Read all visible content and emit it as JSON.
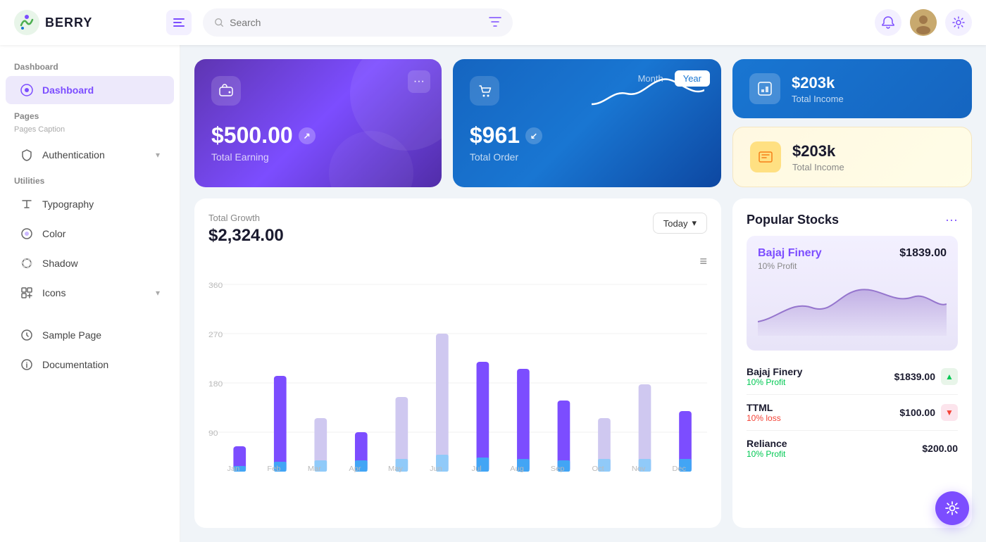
{
  "header": {
    "logo_text": "BERRY",
    "search_placeholder": "Search",
    "hamburger_label": "menu"
  },
  "sidebar": {
    "dashboard_section": "Dashboard",
    "dashboard_item": "Dashboard",
    "pages_section": "Pages",
    "pages_caption": "Pages Caption",
    "auth_item": "Authentication",
    "utilities_section": "Utilities",
    "typography_item": "Typography",
    "color_item": "Color",
    "shadow_item": "Shadow",
    "icons_item": "Icons",
    "sample_page_item": "Sample Page",
    "documentation_item": "Documentation"
  },
  "cards": {
    "earning_amount": "$500.00",
    "earning_label": "Total Earning",
    "order_amount": "$961",
    "order_label": "Total Order",
    "toggle_month": "Month",
    "toggle_year": "Year",
    "income_blue_amount": "$203k",
    "income_blue_label": "Total Income",
    "income_yellow_amount": "$203k",
    "income_yellow_label": "Total Income"
  },
  "growth": {
    "label": "Total Growth",
    "amount": "$2,324.00",
    "today_btn": "Today",
    "y_labels": [
      "360",
      "270",
      "180",
      "90"
    ],
    "x_labels": [
      "Jan",
      "Feb",
      "Mar",
      "Apr",
      "May",
      "Jun",
      "Jul",
      "Aug",
      "Sep",
      "Oct",
      "Nov",
      "Dec"
    ]
  },
  "stocks": {
    "title": "Popular Stocks",
    "featured_name": "Bajaj Finery",
    "featured_value": "$1839.00",
    "featured_profit": "10% Profit",
    "list": [
      {
        "name": "Bajaj Finery",
        "profit": "10% Profit",
        "profit_type": "up",
        "price": "$1839.00"
      },
      {
        "name": "TTML",
        "profit": "10% loss",
        "profit_type": "down",
        "price": "$100.00"
      },
      {
        "name": "Reliance",
        "profit": "10% Profit",
        "profit_type": "up",
        "price": "$200.00"
      }
    ]
  }
}
